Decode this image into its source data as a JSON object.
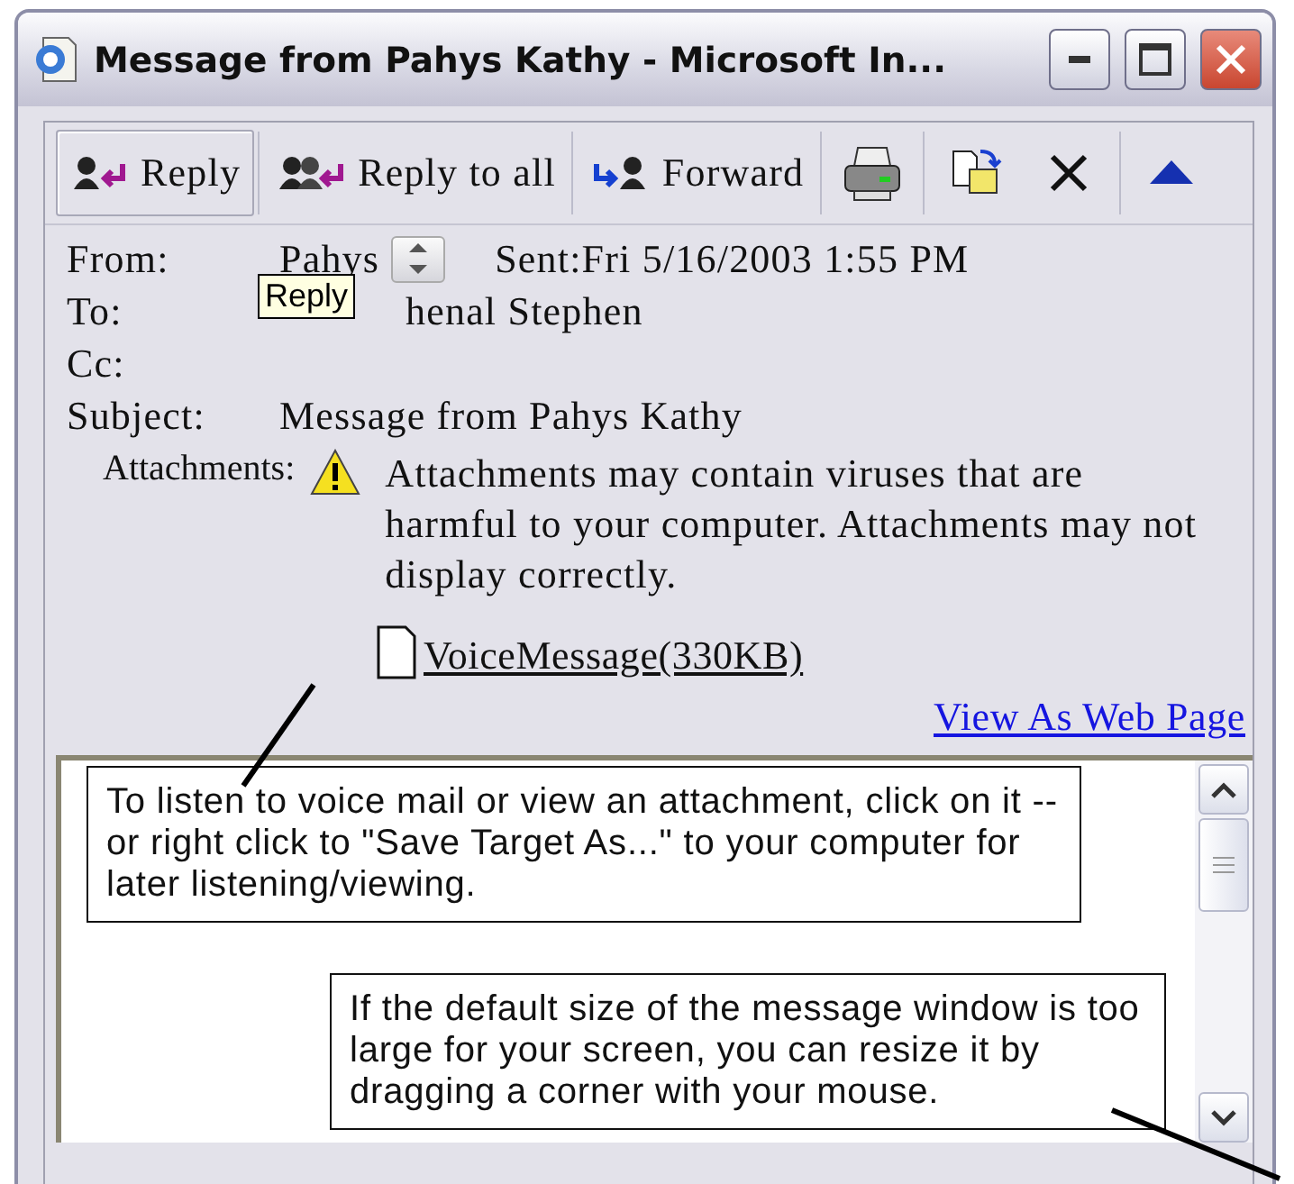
{
  "window": {
    "title": "Message from Pahys Kathy - Microsoft In..."
  },
  "toolbar": {
    "buttons": [
      {
        "label": "Reply",
        "hovered": true
      },
      {
        "label": "Reply to all",
        "hovered": false
      },
      {
        "label": "Forward",
        "hovered": false
      }
    ]
  },
  "tooltip": {
    "text": "Reply"
  },
  "header": {
    "rows": [
      {
        "label": "From:",
        "value": "Pahys",
        "sent": "Sent:Fri 5/16/2003 1:55 PM"
      },
      {
        "label": "To:",
        "value": "henal Stephen"
      },
      {
        "label": "Cc:"
      },
      {
        "label": "Subject:",
        "value": "Message from Pahys Kathy"
      }
    ]
  },
  "attachments": {
    "label": "Attachments:",
    "warning": "Attachments may contain viruses that are harmful to your computer. Attachments may not display correctly.",
    "file": "VoiceMessage(330KB)"
  },
  "link": "View As Web Page",
  "callouts": [
    "To listen to voice mail or view an attachment, click on it -- or right click to \"Save Target As...\" to your computer for later listening/viewing.",
    "If the default size of the message window is too large for your screen, you can resize it by dragging a corner with your mouse."
  ]
}
